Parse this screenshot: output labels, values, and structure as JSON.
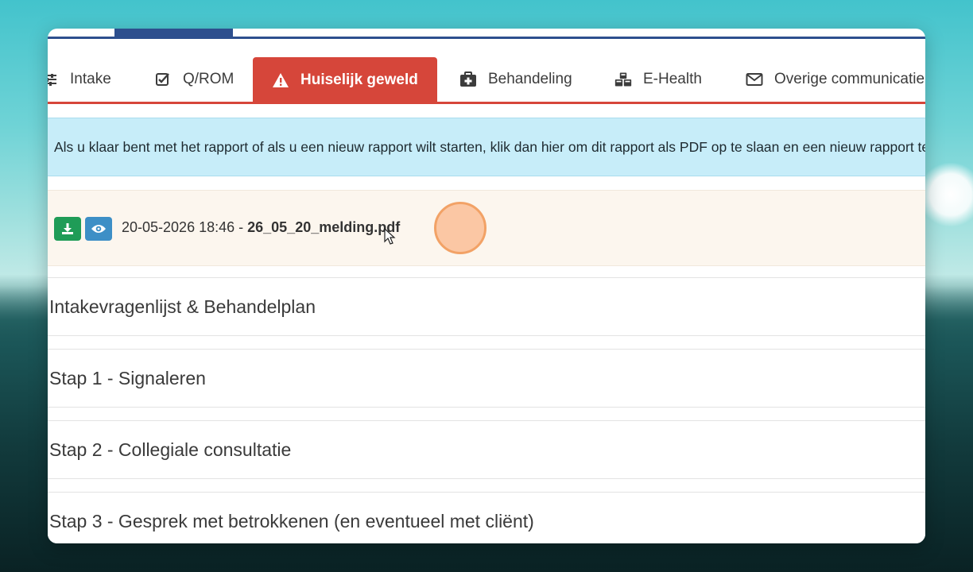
{
  "tabs": [
    {
      "label": "Intake",
      "icon": "sliders-icon",
      "active": false
    },
    {
      "label": "Q/ROM",
      "icon": "checkbox-icon",
      "active": false
    },
    {
      "label": "Huiselijk geweld",
      "icon": "warning-icon",
      "active": true
    },
    {
      "label": "Behandeling",
      "icon": "medkit-icon",
      "active": false
    },
    {
      "label": "E-Health",
      "icon": "cubes-icon",
      "active": false
    },
    {
      "label": "Overige communicatie",
      "icon": "envelope-icon",
      "active": false
    }
  ],
  "info_banner": "Als u klaar bent met het rapport of als u een nieuw rapport wilt starten, klik dan hier om dit rapport als PDF op te slaan en een nieuw rapport te starten.",
  "file": {
    "datetime": "20-05-2026 18:46 - ",
    "filename": "26_05_20_melding.pdf"
  },
  "sections": [
    "Intakevragenlijst & Behandelplan",
    "Stap 1 - Signaleren",
    "Stap 2 - Collegiale consultatie",
    "Stap 3 - Gesprek met betrokkenen (en eventueel met cliënt)"
  ],
  "colors": {
    "active_tab": "#d6463a",
    "nav_blue": "#2d4f8e",
    "download_button": "#1f9c57",
    "view_button": "#3d8fc6",
    "info_bg": "#c7edf9",
    "file_row_bg": "#fcf6ee"
  }
}
